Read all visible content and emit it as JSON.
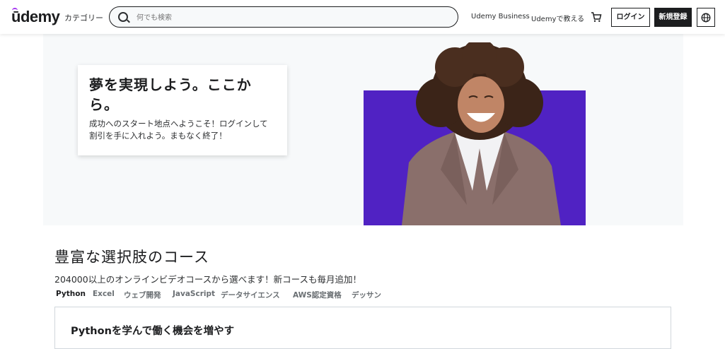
{
  "header": {
    "logo": "ūdemy",
    "categories_label": "カテゴリー",
    "search_placeholder": "何でも検索",
    "business_link": "Udemy Business",
    "teach_link": "Udemyで教える",
    "login_label": "ログイン",
    "signup_label": "新規登録"
  },
  "hero": {
    "title": "夢を実現しよう。ここから。",
    "subtitle": "成功へのスタート地点へようこそ！ログインして割引を手に入れよう。まもなく終了！",
    "accent_color": "#5022c3"
  },
  "courses": {
    "title": "豊富な選択肢のコース",
    "subtitle": "204000以上のオンラインビデオコースから選べます！新コースも毎月追加！",
    "tabs": [
      {
        "label": "Python",
        "active": true
      },
      {
        "label": "Excel",
        "active": false
      },
      {
        "label": "ウェブ開発",
        "active": false
      },
      {
        "label": "JavaScript",
        "active": false
      },
      {
        "label": "データサイエンス",
        "active": false
      },
      {
        "label": "AWS認定資格",
        "active": false
      },
      {
        "label": "デッサン",
        "active": false
      }
    ],
    "panel_heading": "Pythonを学んで働く機会を増やす"
  }
}
